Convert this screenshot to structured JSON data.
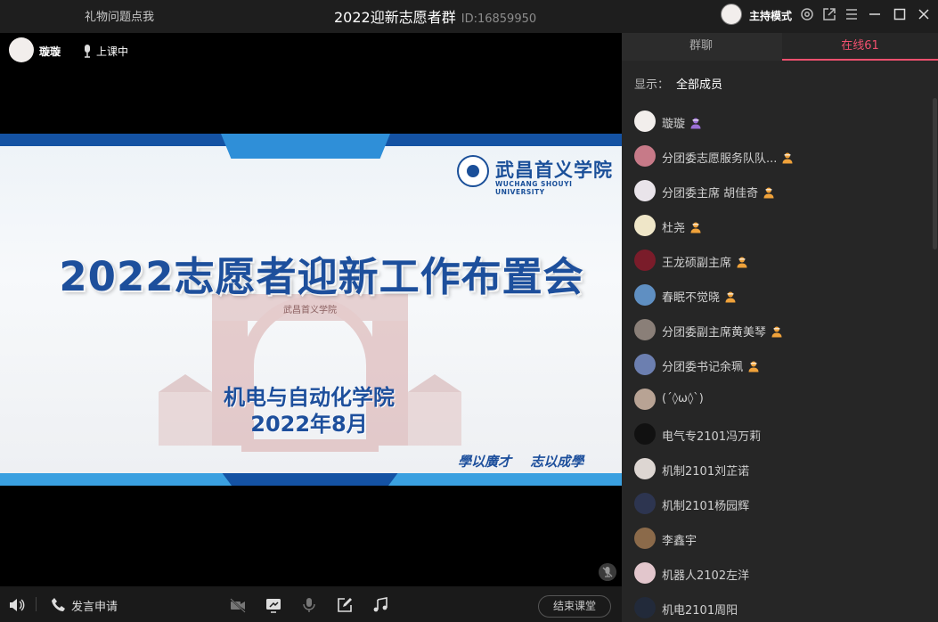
{
  "titlebar": {
    "gift_link": "礼物问题点我",
    "group_name": "2022迎新志愿者群",
    "group_id": "ID:16859950",
    "host_mode": "主持模式"
  },
  "stage": {
    "teacher_name": "璇璇",
    "status": "上课中"
  },
  "slide": {
    "logo_cn": "武昌首义学院",
    "logo_en": "WUCHANG SHOUYI UNIVERSITY",
    "gate_plaque": "武昌首义学院",
    "title": "2022志愿者迎新工作布置会",
    "subtitle1": "机电与自动化学院",
    "subtitle2": "2022年8月",
    "motto": "學以廣才 志以成學"
  },
  "toolbar": {
    "speak_request": "发言申请",
    "end_class": "结束课堂"
  },
  "panel": {
    "tab_chat": "群聊",
    "tab_online": "在线61",
    "filter_label": "显示：",
    "filter_value": "全部成员",
    "members": [
      {
        "name": "璇璇",
        "role": "host",
        "avatar_color": "#f2eeec"
      },
      {
        "name": "分团委志愿服务队队...",
        "role": "admin",
        "avatar_color": "#c77a88"
      },
      {
        "name": "分团委主席 胡佳奇",
        "role": "admin",
        "avatar_color": "#e9e4ea"
      },
      {
        "name": "杜尧",
        "role": "admin",
        "avatar_color": "#efe6c8"
      },
      {
        "name": "王龙硕副主席",
        "role": "admin",
        "avatar_color": "#7a1c2a"
      },
      {
        "name": "春眠不觉晓",
        "role": "admin",
        "avatar_color": "#5f8fc2"
      },
      {
        "name": "分团委副主席黄美琴",
        "role": "admin",
        "avatar_color": "#8a7f78"
      },
      {
        "name": "分团委书记余珮",
        "role": "admin",
        "avatar_color": "#6c7fb0"
      },
      {
        "name": "(ˊ◊ω◊ˋ)",
        "role": "",
        "avatar_color": "#b8a394"
      },
      {
        "name": "电气专2101冯万莉",
        "role": "",
        "avatar_color": "#111111"
      },
      {
        "name": "机制2101刘芷诺",
        "role": "",
        "avatar_color": "#ddd6d2"
      },
      {
        "name": "机制2101杨园辉",
        "role": "",
        "avatar_color": "#2d3550"
      },
      {
        "name": "李鑫宇",
        "role": "",
        "avatar_color": "#8b6a4a"
      },
      {
        "name": "机器人2102左洋",
        "role": "",
        "avatar_color": "#e2c6cc"
      },
      {
        "name": "机电2101周阳",
        "role": "",
        "avatar_color": "#222a3a"
      }
    ]
  },
  "colors": {
    "accent": "#f0506e",
    "host_badge": "#9b6fd6",
    "admin_badge": "#f0a23a",
    "slide_blue": "#1d4f9c"
  }
}
